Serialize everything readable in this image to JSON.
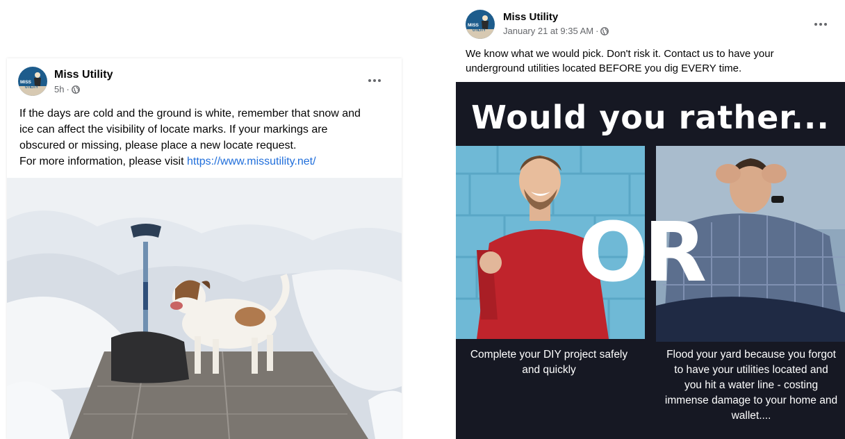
{
  "left_post": {
    "page_name": "Miss Utility",
    "time": "5h",
    "separator": "·",
    "text_lines": [
      "If the days are cold and the ground is white, remember that  snow and",
      "ice can affect the visibility of locate marks. If your markings are",
      "obscured or missing, please place a new locate request.",
      "For more information, please visit "
    ],
    "link_text": "https://www.missutility.net/",
    "avatar_text": "MISS UTILITY",
    "icons": {
      "privacy": "globe-icon",
      "menu": "more-options-icon"
    }
  },
  "right_post": {
    "page_name": "Miss Utility",
    "time": "January 21 at 9:35 AM",
    "separator": "·",
    "text_lines": [
      "We know what we would pick. Don't risk it. Contact us to have your",
      "underground utilities located BEFORE you dig EVERY time."
    ],
    "avatar_text": "MISS UTILITY",
    "graphic": {
      "title": "Would you rather...",
      "or_text": "OR",
      "caption_left": "Complete your DIY project safely and quickly",
      "caption_right": "Flood your yard because you forgot to have your utilities located and you hit a water line - costing immense damage to your home and wallet...."
    }
  },
  "colors": {
    "link": "#216fdb",
    "secondary_text": "#65676b",
    "graphic_background": "#161823",
    "avatar_background": "#1d5c8c"
  }
}
